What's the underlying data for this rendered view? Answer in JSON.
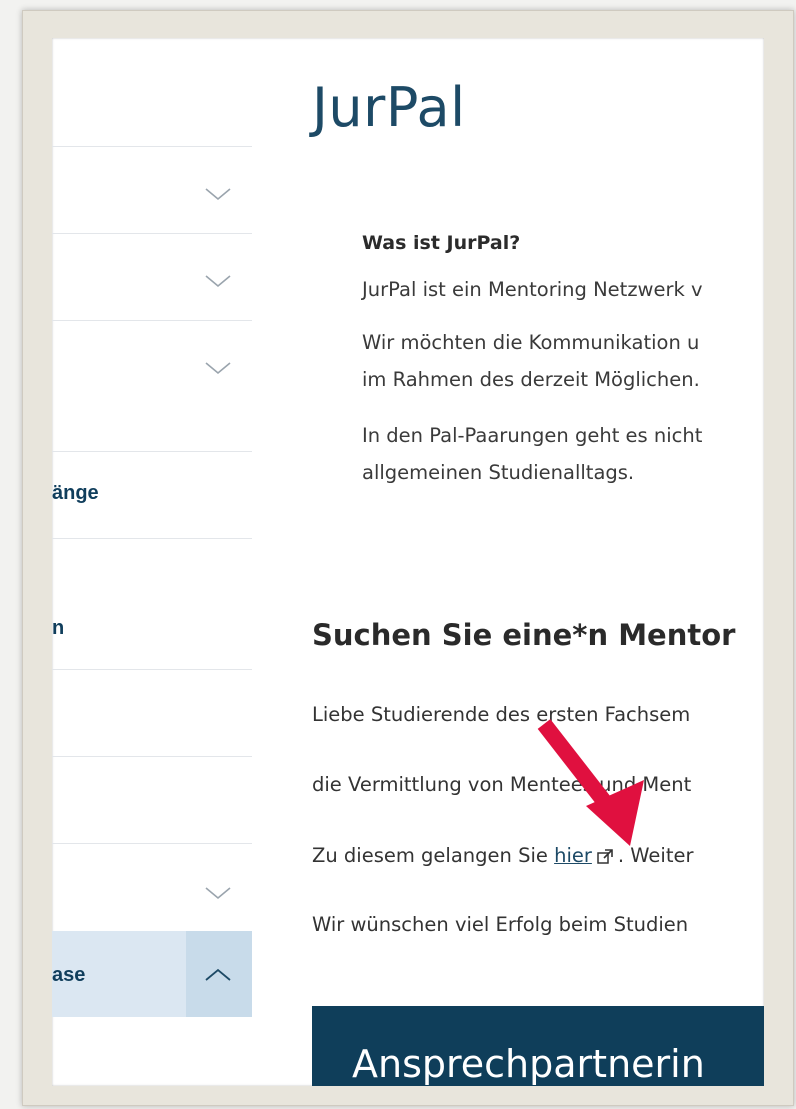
{
  "page": {
    "title": "JurPal"
  },
  "nav": {
    "items": [
      {
        "label": ""
      },
      {
        "label": ""
      },
      {
        "label": ""
      },
      {
        "label": "änge"
      },
      {
        "label": "n"
      },
      {
        "label": ""
      },
      {
        "label": ""
      },
      {
        "label": ""
      },
      {
        "label": "ase"
      }
    ]
  },
  "info": {
    "heading": "Was ist JurPal?",
    "p1": "JurPal ist ein Mentoring Netzwerk v",
    "p2_line1": "Wir möchten die Kommunikation u",
    "p2_line2": "im Rahmen des derzeit Möglichen.",
    "p3_line1": "In den Pal-Paarungen geht es nicht",
    "p3_line2": "allgemeinen Studienalltags."
  },
  "mentor": {
    "heading": "Suchen Sie eine*n Mentor",
    "line1": "Liebe Studierende des ersten Fachsem",
    "line2": "die Vermittlung von Mentees und Ment",
    "line3_prefix": "Zu diesem gelangen Sie",
    "line3_link": "hier",
    "line3_suffix": ". Weiter",
    "line4": "Wir wünschen viel Erfolg beim Studien"
  },
  "cta": {
    "label": "Ansprechpartnerin"
  },
  "colors": {
    "brand": "#0f3e5a",
    "nav_active": "#dbe7f2",
    "arrow": "#e0103f"
  },
  "icons": {
    "nav_expand": "chevron-down-icon",
    "nav_collapse": "chevron-up-icon",
    "external": "external-link-icon",
    "annotation": "red-arrow-icon"
  }
}
